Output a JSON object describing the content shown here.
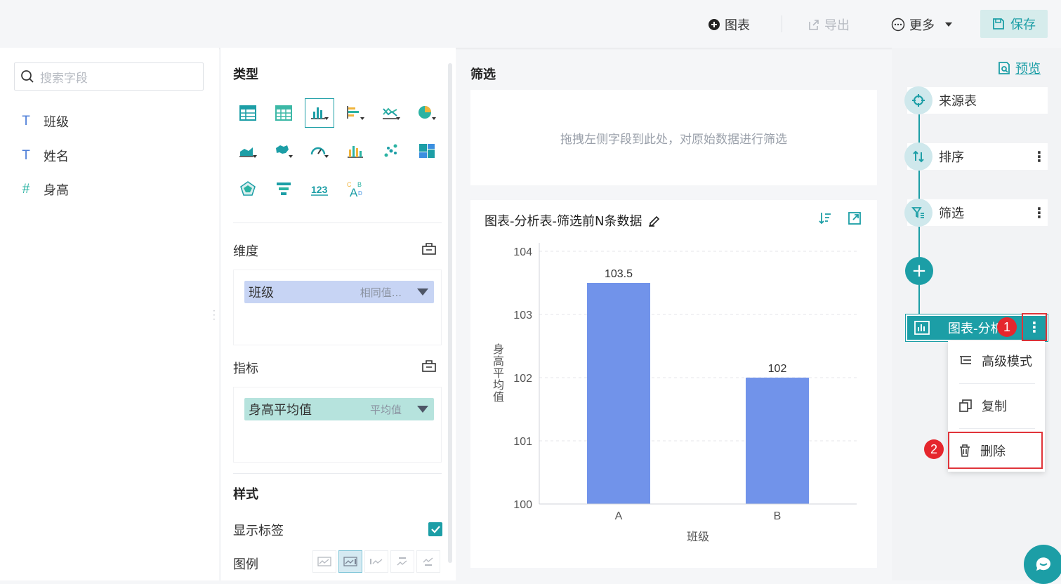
{
  "toolbar": {
    "chart_label": "图表",
    "export_label": "导出",
    "more_label": "更多",
    "save_label": "保存"
  },
  "fields_panel": {
    "search_placeholder": "搜索字段",
    "fields": [
      {
        "type_symbol": "T",
        "label": "班级"
      },
      {
        "type_symbol": "T",
        "label": "姓名"
      },
      {
        "type_symbol": "#",
        "label": "身高"
      }
    ]
  },
  "config": {
    "type_title": "类型",
    "chart_types": [
      "table-icon",
      "cross-table-icon",
      "column-chart-icon",
      "bar-chart-icon",
      "line-chart-icon",
      "pie-chart-icon",
      "area-chart-icon",
      "map-icon",
      "gauge-icon",
      "combo-chart-icon",
      "scatter-icon",
      "treemap-icon",
      "radar-icon",
      "funnel-icon",
      "number-card-icon",
      "word-cloud-icon"
    ],
    "active_chart_type": "column-chart-icon",
    "dimension_label": "维度",
    "dimension_pill": {
      "label": "班级",
      "sub": "相同值..."
    },
    "metric_label": "指标",
    "metric_pill": {
      "label": "身高平均值",
      "sub": "平均值"
    },
    "style_title": "样式",
    "show_labels": "显示标签",
    "show_labels_checked": true,
    "legend_label": "图例"
  },
  "main": {
    "filter_title": "筛选",
    "filter_hint": "拖拽左侧字段到此处，对原始数据进行筛选",
    "chart_title": "图表-分析表-筛选前N条数据"
  },
  "chart_data": {
    "type": "bar",
    "categories": [
      "A",
      "B"
    ],
    "values": [
      103.5,
      102
    ],
    "data_labels": [
      "103.5",
      "102"
    ],
    "xlabel": "班级",
    "ylabel": "身高平均值",
    "ylim": [
      100,
      104
    ],
    "yticks": [
      "100",
      "101",
      "102",
      "103",
      "104"
    ],
    "bar_color": "#7193ea",
    "grid": true
  },
  "flow": {
    "preview_label": "预览",
    "steps": [
      {
        "label": "来源表",
        "icon": "target-icon"
      },
      {
        "label": "排序",
        "icon": "sort-icon"
      },
      {
        "label": "筛选",
        "icon": "filter-icon"
      }
    ],
    "add_symbol": "+",
    "chart_step_label": "图表-分析",
    "menu": [
      {
        "label": "高级模式",
        "icon": "advanced-mode-icon"
      },
      {
        "label": "复制",
        "icon": "copy-icon"
      },
      {
        "label": "删除",
        "icon": "trash-icon"
      }
    ],
    "badges": [
      "1",
      "2"
    ]
  },
  "colors": {
    "accent": "#1c9ea6",
    "dimension_pill": "#c7d4f4",
    "metric_pill": "#b6e3dd",
    "highlight_red": "#e0343a"
  }
}
